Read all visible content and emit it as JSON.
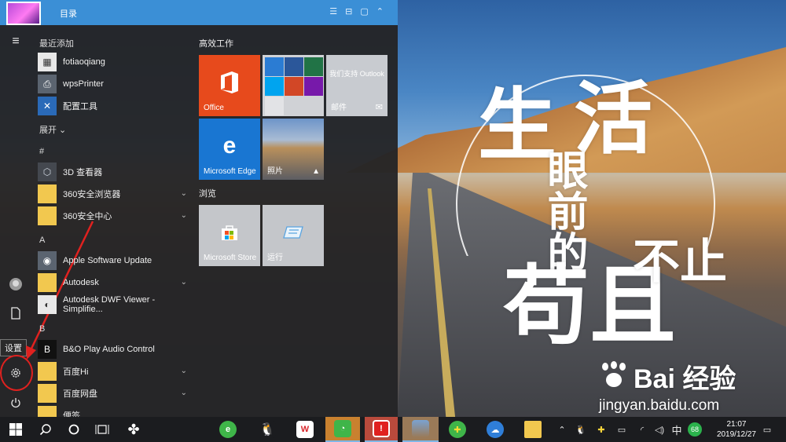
{
  "window": {
    "title": "目录",
    "icons": [
      "list-icon",
      "lock-icon",
      "square-icon",
      "chevron-up-icon"
    ]
  },
  "wallpaper": {
    "calligraphy": [
      "生",
      "活",
      "眼前的",
      "苟且",
      "不止"
    ],
    "watermark_logo": "Bai  经验",
    "watermark_url": "jingyan.baidu.com"
  },
  "rail": {
    "settings_tooltip": "设置",
    "buttons": [
      "menu-icon",
      "user-icon",
      "documents-icon",
      "settings-icon",
      "power-icon"
    ]
  },
  "app_list": {
    "recent_header": "最近添加",
    "recent": [
      {
        "label": "fotiaoqiang",
        "icon": "fotiaoqiang-icon"
      },
      {
        "label": "wpsPrinter",
        "icon": "printer-icon"
      },
      {
        "label": "配置工具",
        "icon": "tools-icon"
      }
    ],
    "expand_label": "展开",
    "hash_header": "#",
    "hash_items": [
      {
        "label": "3D 查看器",
        "icon": "cube-icon",
        "folder": false
      },
      {
        "label": "360安全浏览器",
        "icon": "folder-icon",
        "folder": true
      },
      {
        "label": "360安全中心",
        "icon": "folder-icon",
        "folder": true
      }
    ],
    "a_header": "A",
    "a_items": [
      {
        "label": "Apple Software Update",
        "icon": "apple-update-icon",
        "folder": false
      },
      {
        "label": "Autodesk",
        "icon": "folder-icon",
        "folder": true
      },
      {
        "label": "Autodesk DWF Viewer - Simplifie...",
        "icon": "autodesk-icon",
        "folder": false
      }
    ],
    "b_header": "B",
    "b_items": [
      {
        "label": "B&O Play Audio Control",
        "icon": "bo-icon",
        "folder": false
      },
      {
        "label": "百度Hi",
        "icon": "folder-icon",
        "folder": true
      },
      {
        "label": "百度网盘",
        "icon": "folder-icon",
        "folder": true
      },
      {
        "label": "便签",
        "icon": "sticky-notes-icon",
        "folder": false
      }
    ]
  },
  "tiles": {
    "group1": "高效工作",
    "office": "Office",
    "outlook_text": "我们支持 Outlook",
    "mail": "邮件",
    "edge": "Microsoft Edge",
    "photos": "照片",
    "group2": "浏览",
    "store": "Microsoft Store",
    "run": "运行"
  },
  "taskbar": {
    "apps": [
      "start-icon",
      "search-icon",
      "cortana-icon",
      "task-view-icon",
      "fan-icon",
      "360browser-icon",
      "qq-icon",
      "wps-icon",
      "wechat-icon",
      "power-app-icon",
      "road-photo-icon",
      "360security-icon",
      "baidu-netdisk-icon",
      "file-explorer-icon"
    ],
    "ime": "中",
    "badge": "68",
    "time": "21:07",
    "date": "2019/12/27"
  },
  "colors": {
    "accent": "#3b8fd6",
    "office": "#e74a1c",
    "edge": "#1976d2",
    "highlight": "#e0211f"
  }
}
